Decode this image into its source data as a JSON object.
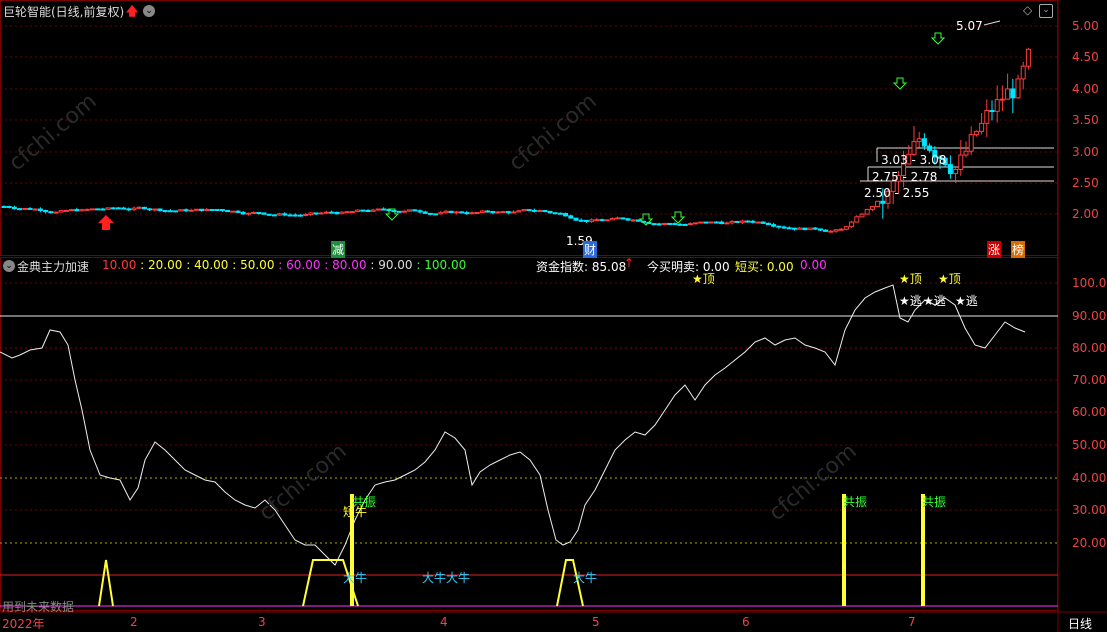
{
  "top_panel": {
    "title": "巨轮智能(日线,前复权)",
    "price_axis": [
      "5.00",
      "4.50",
      "4.00",
      "3.50",
      "3.00",
      "2.50",
      "2.00"
    ],
    "annotations": {
      "high": "5.07",
      "low": "1.59",
      "range1": "3.03 - 3.08",
      "range2": "2.75 - 2.78",
      "range3": "2.50 - 2.55",
      "cai": "财",
      "jian": "减",
      "zhang": "涨",
      "bang": "榜"
    }
  },
  "bottom_panel": {
    "indicator_name": "金典主力加速",
    "levels": [
      {
        "text": "10.00",
        "color": "#ff3b3b"
      },
      {
        "text": "20.00",
        "color": "#ffff33"
      },
      {
        "text": "40.00",
        "color": "#ffff33"
      },
      {
        "text": "50.00",
        "color": "#ffff33"
      },
      {
        "text": "60.00",
        "color": "#ff33ff"
      },
      {
        "text": "80.00",
        "color": "#ff33ff"
      },
      {
        "text": "90.00",
        "color": "#dddddd"
      },
      {
        "text": "100.00",
        "color": "#33ff33"
      }
    ],
    "fund_index_label": "资金指数: 85.08",
    "buy_sell_label": "今买明卖: 0.00",
    "short_buy_label": "短买: 0.00",
    "extra_value": "0.00",
    "value_axis": [
      "100.0",
      "90.00",
      "80.00",
      "70.00",
      "60.00",
      "50.00",
      "40.00",
      "30.00",
      "20.00"
    ],
    "signals": {
      "gongzhen": "共振",
      "duanniu": "短牛",
      "daniu": "大牛",
      "daniu_pair": "大牛大牛",
      "tao": "★逃",
      "gu": "★顶",
      "future_data": "用到未来数据"
    }
  },
  "time_axis": [
    "2022年",
    "2",
    "3",
    "4",
    "5",
    "6",
    "7"
  ],
  "period_label": "日线",
  "watermark": "cfchi.com",
  "colors": {
    "up": "#ff3b3b",
    "down": "#00e5ff",
    "yellow": "#ffff33",
    "green": "#33ff33",
    "magenta": "#ff33ff",
    "grid_red": "#8b0000"
  }
}
